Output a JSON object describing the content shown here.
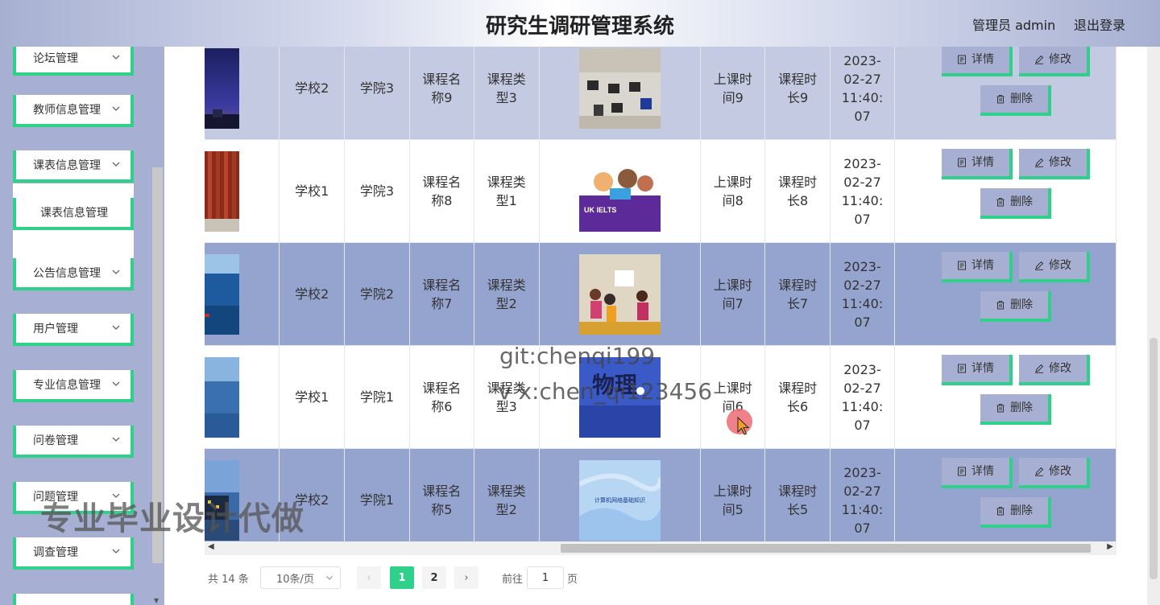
{
  "header": {
    "title": "研究生调研管理系统",
    "user": "管理员 admin",
    "logout": "退出登录"
  },
  "sidebar": {
    "items": [
      {
        "label": "论坛管理",
        "top": 0
      },
      {
        "label": "教师信息管理"
      },
      {
        "label": "课表信息管理"
      },
      {
        "label": "课表信息管理"
      },
      {
        "label": "公告信息管理"
      },
      {
        "label": "用户管理"
      },
      {
        "label": "专业信息管理"
      },
      {
        "label": "问卷管理"
      },
      {
        "label": "问题管理"
      },
      {
        "label": "调查管理"
      }
    ]
  },
  "table": {
    "rows": [
      {
        "school": "学校2",
        "college": "学院3",
        "course_name": "课程名称9",
        "course_type": "课程类型3",
        "class_time": "上课时间9",
        "duration": "课程时长9",
        "date": "2023-02-27 11:40:07"
      },
      {
        "school": "学校1",
        "college": "学院3",
        "course_name": "课程名称8",
        "course_type": "课程类型1",
        "class_time": "上课时间8",
        "duration": "课程时长8",
        "date": "2023-02-27 11:40:07"
      },
      {
        "school": "学校2",
        "college": "学院2",
        "course_name": "课程名称7",
        "course_type": "课程类型2",
        "class_time": "上课时间7",
        "duration": "课程时长7",
        "date": "2023-02-27 11:40:07"
      },
      {
        "school": "学校1",
        "college": "学院1",
        "course_name": "课程名称6",
        "course_type": "课程类型3",
        "class_time": "上课时间6",
        "duration": "课程时长6",
        "date": "2023-02-27 11:40:07"
      },
      {
        "school": "学校2",
        "college": "学院1",
        "course_name": "课程名称5",
        "course_type": "课程类型2",
        "class_time": "上课时间5",
        "duration": "课程时长5",
        "date": "2023-02-27 11:40:07"
      }
    ],
    "actions": {
      "detail": "详情",
      "edit": "修改",
      "delete": "删除"
    },
    "thumb_texts": {
      "physics": "物理",
      "network": "计算机网络基础知识",
      "ielts": "UK IELTS"
    }
  },
  "pagination": {
    "total": "共 14 条",
    "page_size": "10条/页",
    "pages": [
      "1",
      "2"
    ],
    "current": "1",
    "goto_label": "前往",
    "goto_value": "1",
    "page_suffix": "页"
  },
  "watermarks": {
    "git": "git:chenqi199",
    "vx": "v x:chen_qi123456",
    "promo": "专业毕业设计代做"
  },
  "colors": {
    "accent": "#2ed08a",
    "sidebar_bg": "#a7b0d2",
    "row_dark": "#95a4cf",
    "row_light": "#c4cae1"
  }
}
